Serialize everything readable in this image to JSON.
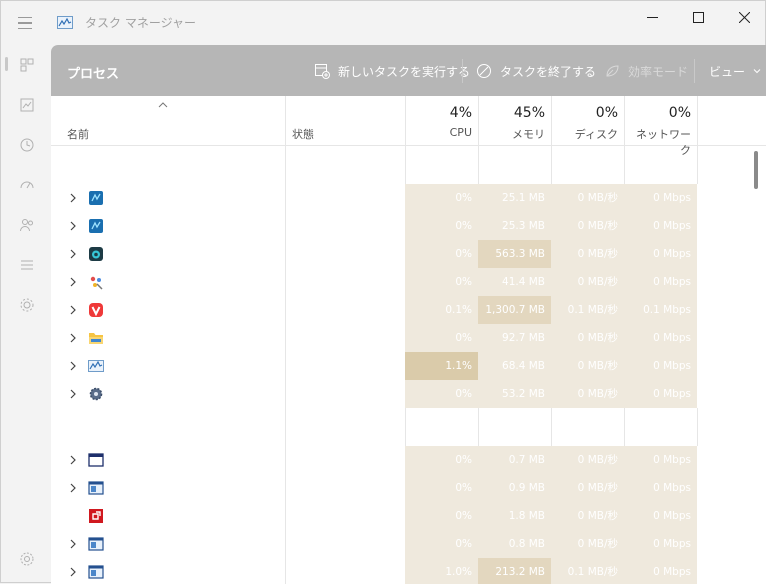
{
  "app": {
    "title": "タスク マネージャー"
  },
  "window_controls": {
    "minimize": "—",
    "maximize": "☐",
    "close": "✕"
  },
  "nav": {
    "items": [
      {
        "name": "processes",
        "icon": "processes-icon"
      },
      {
        "name": "performance",
        "icon": "performance-icon"
      },
      {
        "name": "app-history",
        "icon": "history-icon"
      },
      {
        "name": "startup",
        "icon": "startup-icon"
      },
      {
        "name": "users",
        "icon": "users-icon"
      },
      {
        "name": "details",
        "icon": "details-icon"
      },
      {
        "name": "services",
        "icon": "services-icon"
      },
      {
        "name": "settings",
        "icon": "gear-icon"
      }
    ]
  },
  "commandbar": {
    "page_title": "プロセス",
    "run_new_task": "新しいタスクを実行する",
    "end_task": "タスクを終了する",
    "efficiency_mode": "効率モード",
    "view": "ビュー"
  },
  "columns": {
    "name": "名前",
    "status": "状態",
    "cpu_pct": "4%",
    "cpu": "CPU",
    "memory_pct": "45%",
    "memory": "メモリ",
    "disk_pct": "0%",
    "disk": "ディスク",
    "network_pct": "0%",
    "network": "ネットワーク"
  },
  "apps": [
    {
      "icon": "app-blue-icon",
      "cpu": "0%",
      "mem": "25.1 MB",
      "disk": "0 MB/秒",
      "net": "0 Mbps",
      "chevron": true
    },
    {
      "icon": "app-blue-icon",
      "cpu": "0%",
      "mem": "25.3 MB",
      "disk": "0 MB/秒",
      "net": "0 Mbps",
      "chevron": true
    },
    {
      "icon": "camera-icon",
      "cpu": "0%",
      "mem": "563.3 MB",
      "disk": "0 MB/秒",
      "net": "0 Mbps",
      "chevron": true,
      "mem_hl": true
    },
    {
      "icon": "paint-icon",
      "cpu": "0%",
      "mem": "41.4 MB",
      "disk": "0 MB/秒",
      "net": "0 Mbps",
      "chevron": true
    },
    {
      "icon": "vivaldi-icon",
      "cpu": "0.1%",
      "mem": "1,300.7 MB",
      "disk": "0.1 MB/秒",
      "net": "0.1 Mbps",
      "chevron": true,
      "mem_hl": true
    },
    {
      "icon": "folder-icon",
      "cpu": "0%",
      "mem": "92.7 MB",
      "disk": "0 MB/秒",
      "net": "0 Mbps",
      "chevron": true
    },
    {
      "icon": "task-manager-icon",
      "cpu": "1.1%",
      "mem": "68.4 MB",
      "disk": "0 MB/秒",
      "net": "0 Mbps",
      "chevron": true,
      "cpu_hl": true
    },
    {
      "icon": "settings-app-icon",
      "cpu": "0%",
      "mem": "53.2 MB",
      "disk": "0 MB/秒",
      "net": "0 Mbps",
      "chevron": true
    }
  ],
  "background": [
    {
      "icon": "window-icon",
      "cpu": "0%",
      "mem": "0.7 MB",
      "disk": "0 MB/秒",
      "net": "0 Mbps",
      "chevron": true
    },
    {
      "icon": "service-window-icon",
      "cpu": "0%",
      "mem": "0.9 MB",
      "disk": "0 MB/秒",
      "net": "0 Mbps",
      "chevron": true
    },
    {
      "icon": "amd-icon",
      "cpu": "0%",
      "mem": "1.8 MB",
      "disk": "0 MB/秒",
      "net": "0 Mbps",
      "chevron": false
    },
    {
      "icon": "service-window-icon",
      "cpu": "0%",
      "mem": "0.8 MB",
      "disk": "0 MB/秒",
      "net": "0 Mbps",
      "chevron": true
    },
    {
      "icon": "service-window-icon",
      "cpu": "1.0%",
      "mem": "213.2 MB",
      "disk": "0.1 MB/秒",
      "net": "0 Mbps",
      "chevron": true,
      "mem_hl": true
    }
  ]
}
